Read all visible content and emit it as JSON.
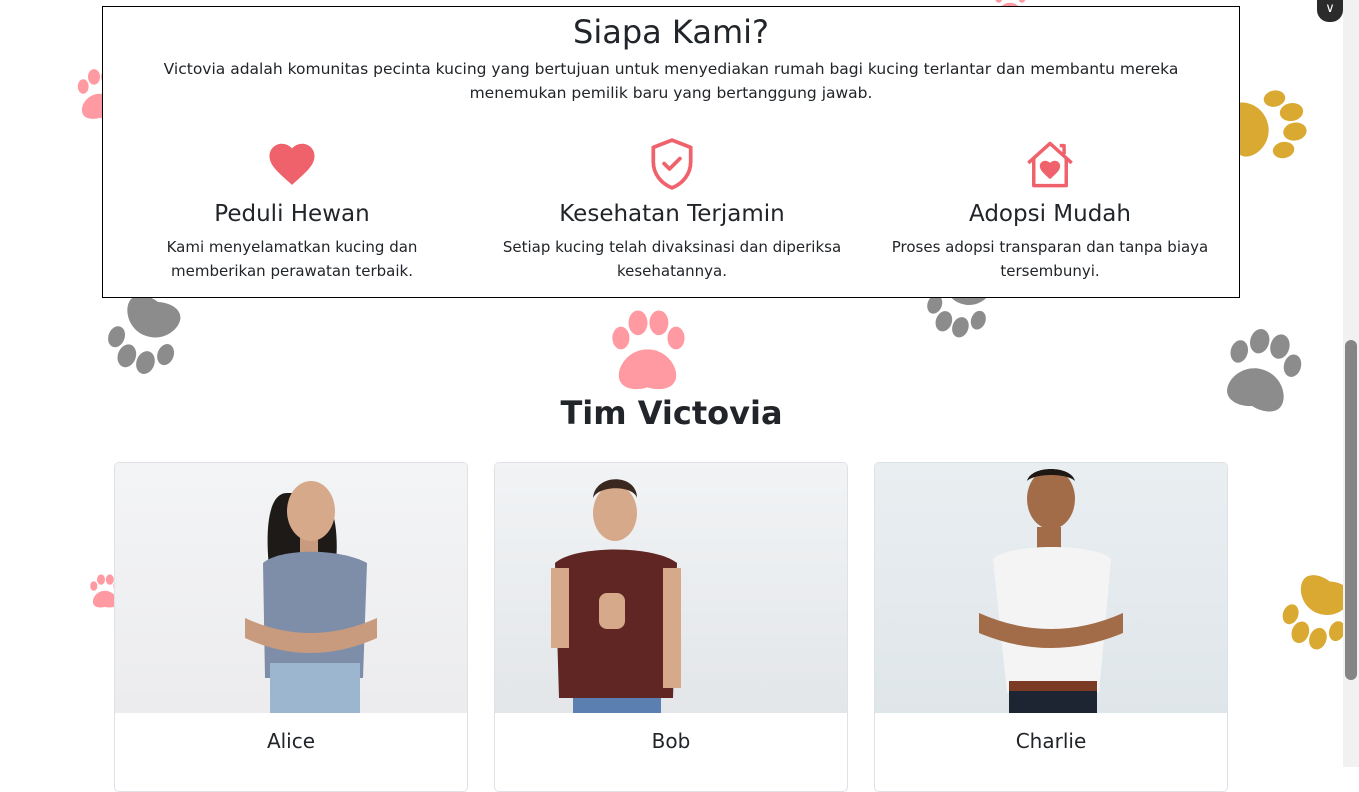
{
  "about": {
    "title": "Siapa Kami?",
    "description": "Victovia adalah komunitas pecinta kucing yang bertujuan untuk menyediakan rumah bagi kucing terlantar dan membantu mereka menemukan pemilik baru yang bertanggung jawab.",
    "features": [
      {
        "icon": "heart-icon",
        "title": "Peduli Hewan",
        "text": "Kami menyelamatkan kucing dan memberikan perawatan terbaik."
      },
      {
        "icon": "shield-check-icon",
        "title": "Kesehatan Terjamin",
        "text": "Setiap kucing telah divaksinasi dan diperiksa kesehatannya."
      },
      {
        "icon": "house-heart-icon",
        "title": "Adopsi Mudah",
        "text": "Proses adopsi transparan dan tanpa biaya tersembunyi."
      }
    ]
  },
  "team": {
    "title": "Tim Victovia",
    "members": [
      {
        "name": "Alice"
      },
      {
        "name": "Bob"
      },
      {
        "name": "Charlie"
      }
    ]
  },
  "colors": {
    "accent": "#f0626b",
    "paw_pink": "#ff9aa2",
    "paw_gray": "#8c8c8c",
    "paw_gold": "#d9a932"
  }
}
